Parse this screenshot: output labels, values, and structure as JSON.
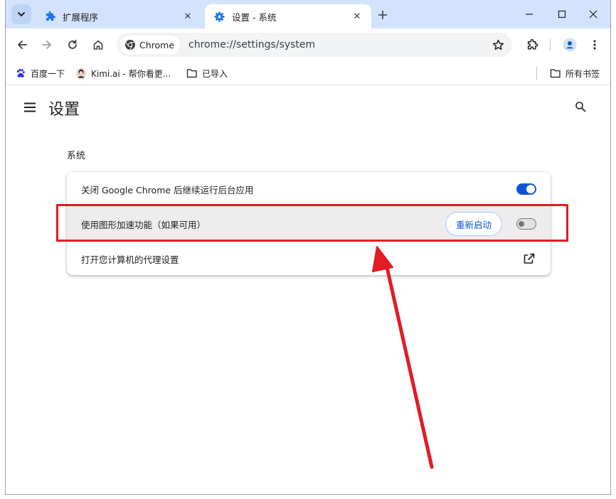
{
  "tabs": [
    {
      "title": "扩展程序",
      "icon": "puzzle-icon",
      "active": false
    },
    {
      "title": "设置 - 系统",
      "icon": "gear-icon",
      "active": true
    }
  ],
  "toolbar": {
    "site_chip_label": "Chrome",
    "url": "chrome://settings/system"
  },
  "bookmarks": {
    "items": [
      {
        "label": "百度一下",
        "icon": "baidu-paw-icon"
      },
      {
        "label": "Kimi.ai - 帮你看更...",
        "icon": "kimi-avatar-icon"
      },
      {
        "label": "已导入",
        "icon": "folder-icon"
      }
    ],
    "all_bookmarks_label": "所有书签"
  },
  "settings": {
    "page_title": "设置",
    "section_heading": "系统",
    "rows": [
      {
        "label": "关闭 Google Chrome 后继续运行后台应用",
        "control": "toggle",
        "enabled": true
      },
      {
        "label": "使用图形加速功能（如果可用）",
        "control": "toggle",
        "enabled": false,
        "relaunch_label": "重新启动"
      },
      {
        "label": "打开您计算机的代理设置",
        "control": "external-link"
      }
    ]
  },
  "colors": {
    "tabstrip": "#d3e3fd",
    "accent": "#0b57d0",
    "annotation": "#e31b23",
    "highlighted_row": "#ededed"
  }
}
